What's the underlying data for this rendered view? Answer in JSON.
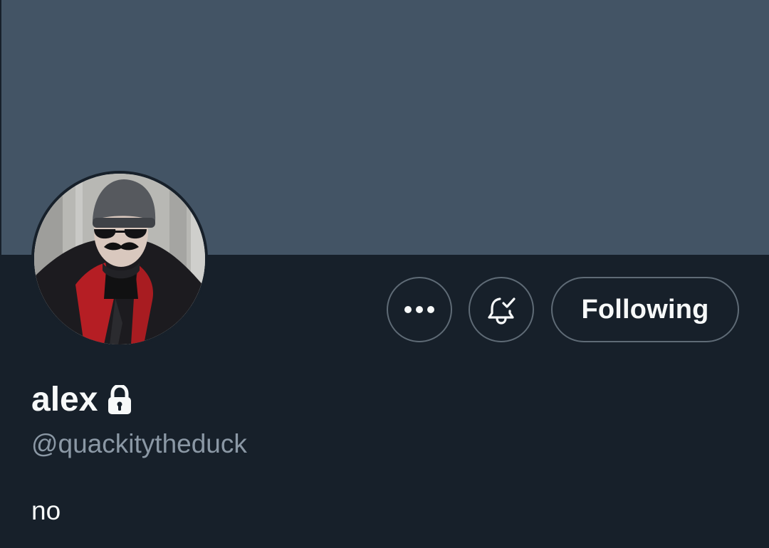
{
  "profile": {
    "display_name": "alex",
    "handle": "@quackitytheduck",
    "bio": "no",
    "protected_icon": "lock-icon",
    "avatar_icon": "avatar-photo"
  },
  "actions": {
    "more_icon": "more-icon",
    "notification_icon": "bell-check-icon",
    "follow_label": "Following"
  },
  "colors": {
    "background": "#17202a",
    "banner": "#435465",
    "primary_text": "#f7f9f9",
    "secondary_text": "#8b98a5",
    "button_border": "#5f6b76"
  }
}
